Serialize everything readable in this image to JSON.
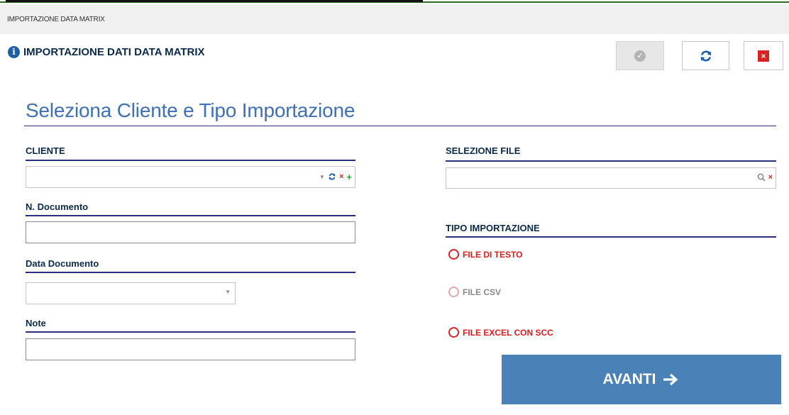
{
  "window": {
    "title": "IMPORTAZIONE DATA MATRIX"
  },
  "header": {
    "title": "IMPORTAZIONE DATI DATA MATRIX",
    "info_icon": "info-icon",
    "actions": [
      {
        "name": "confirm",
        "icon": "check-circle-icon",
        "enabled": false
      },
      {
        "name": "refresh",
        "icon": "refresh-icon"
      },
      {
        "name": "close",
        "icon": "close-icon"
      }
    ]
  },
  "section": {
    "title": "Seleziona Cliente e  Tipo Importazione"
  },
  "form": {
    "cliente": {
      "label": "CLIENTE",
      "value": ""
    },
    "n_documento": {
      "label": "N. Documento",
      "value": ""
    },
    "data_documento": {
      "label": "Data Documento",
      "value": ""
    },
    "note": {
      "label": "Note",
      "value": ""
    },
    "selezione_file": {
      "label": "SELEZIONE FILE",
      "value": ""
    },
    "tipo_importazione": {
      "label": "TIPO IMPORTAZIONE",
      "options": [
        {
          "label": "FILE DI TESTO",
          "enabled": true
        },
        {
          "label": "FILE CSV",
          "enabled": false
        },
        {
          "label": "FILE EXCEL CON SCC",
          "enabled": true
        }
      ]
    }
  },
  "next_button": {
    "label": "AVANTI",
    "icon": "arrow-right-icon"
  },
  "colors": {
    "accent_blue": "#3f6fb6",
    "button_blue": "#4a82b8",
    "danger_red": "#d82323",
    "rule_navy": "#2a2f7d"
  }
}
